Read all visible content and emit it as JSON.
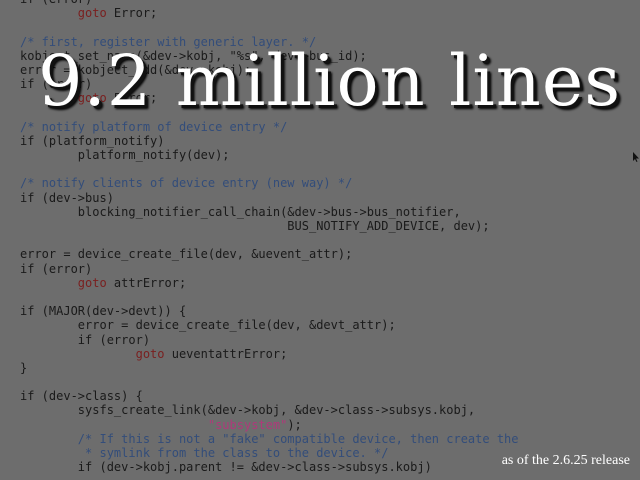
{
  "slide": {
    "title": "9.2 million lines",
    "note": "as of the 2.6.25 release"
  },
  "code_lines": [
    [
      {
        "t": "if (error)",
        "c": "tx"
      }
    ],
    [
      {
        "t": "        ",
        "c": "tx"
      },
      {
        "t": "goto",
        "c": "kw"
      },
      {
        "t": " Error;",
        "c": "tx"
      }
    ],
    [
      {
        "t": "",
        "c": "tx"
      }
    ],
    [
      {
        "t": "/* first, register with generic layer. */",
        "c": "cm"
      }
    ],
    [
      {
        "t": "kobject_set_name(&dev->kobj, \"%s\", dev->bus_id);",
        "c": "tx"
      }
    ],
    [
      {
        "t": "error = kobject_add(&dev->kobj);",
        "c": "tx"
      }
    ],
    [
      {
        "t": "if (error)",
        "c": "tx"
      }
    ],
    [
      {
        "t": "        ",
        "c": "tx"
      },
      {
        "t": "goto",
        "c": "kw"
      },
      {
        "t": " Error;",
        "c": "tx"
      }
    ],
    [
      {
        "t": "",
        "c": "tx"
      }
    ],
    [
      {
        "t": "/* notify platform of device entry */",
        "c": "cm"
      }
    ],
    [
      {
        "t": "if (platform_notify)",
        "c": "tx"
      }
    ],
    [
      {
        "t": "        platform_notify(dev);",
        "c": "tx"
      }
    ],
    [
      {
        "t": "",
        "c": "tx"
      }
    ],
    [
      {
        "t": "/* notify clients of device entry (new way) */",
        "c": "cm"
      }
    ],
    [
      {
        "t": "if (dev->bus)",
        "c": "tx"
      }
    ],
    [
      {
        "t": "        blocking_notifier_call_chain(&dev->bus->bus_notifier,",
        "c": "tx"
      }
    ],
    [
      {
        "t": "                                     BUS_NOTIFY_ADD_DEVICE, dev);",
        "c": "tx"
      }
    ],
    [
      {
        "t": "",
        "c": "tx"
      }
    ],
    [
      {
        "t": "error = device_create_file(dev, &uevent_attr);",
        "c": "tx"
      }
    ],
    [
      {
        "t": "if (error)",
        "c": "tx"
      }
    ],
    [
      {
        "t": "        ",
        "c": "tx"
      },
      {
        "t": "goto",
        "c": "kw"
      },
      {
        "t": " attrError;",
        "c": "tx"
      }
    ],
    [
      {
        "t": "",
        "c": "tx"
      }
    ],
    [
      {
        "t": "if (MAJOR(dev->devt)) {",
        "c": "tx"
      }
    ],
    [
      {
        "t": "        error = device_create_file(dev, &devt_attr);",
        "c": "tx"
      }
    ],
    [
      {
        "t": "        if (error)",
        "c": "tx"
      }
    ],
    [
      {
        "t": "                ",
        "c": "tx"
      },
      {
        "t": "goto",
        "c": "kw"
      },
      {
        "t": " ueventattrError;",
        "c": "tx"
      }
    ],
    [
      {
        "t": "}",
        "c": "tx"
      }
    ],
    [
      {
        "t": "",
        "c": "tx"
      }
    ],
    [
      {
        "t": "if (dev->class) {",
        "c": "tx"
      }
    ],
    [
      {
        "t": "        sysfs_create_link(&dev->kobj, &dev->class->subsys.kobj,",
        "c": "tx"
      }
    ],
    [
      {
        "t": "                          ",
        "c": "tx"
      },
      {
        "t": "\"subsystem\"",
        "c": "st"
      },
      {
        "t": ");",
        "c": "tx"
      }
    ],
    [
      {
        "t": "        /* If this is not a \"fake\" compatible device, then create the",
        "c": "cm"
      }
    ],
    [
      {
        "t": "         * symlink from the class to the device. */",
        "c": "cm"
      }
    ],
    [
      {
        "t": "        if (dev->kobj.parent != &dev->class->subsys.kobj)",
        "c": "tx"
      }
    ]
  ],
  "colors": {
    "background": "#6d6d6d",
    "comment": "#334d7a",
    "keyword": "#7a1f1f",
    "string": "#b0397a",
    "title": "#ffffff"
  },
  "icons": {
    "cursor": "mouse-cursor-icon"
  }
}
